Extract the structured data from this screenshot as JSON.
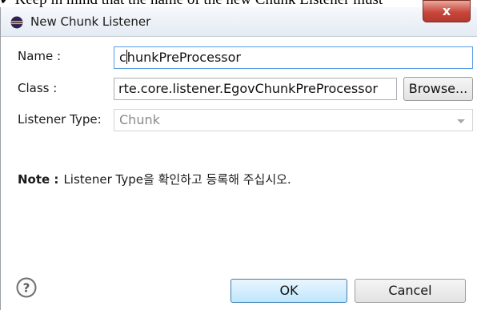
{
  "caption": {
    "text": "Keep in mind that the name of the new Chunk Listener must"
  },
  "window": {
    "title": "New Chunk Listener",
    "close_glyph": "x"
  },
  "form": {
    "name_label": "Name :",
    "name_value_before_caret": "c",
    "name_value_after_caret": "hunkPreProcessor",
    "class_label": "Class :",
    "class_value": "rte.core.listener.EgovChunkPreProcessor",
    "browse_label": "Browse...",
    "listener_type_label": "Listener Type:",
    "listener_type_value": "Chunk"
  },
  "note": {
    "label": "Note :",
    "text": "Listener Type을 확인하고 등록해 주십시오."
  },
  "buttons": {
    "ok": "OK",
    "cancel": "Cancel"
  },
  "icons": {
    "app": "eclipse-icon",
    "help": "help-icon",
    "close": "close-icon",
    "dropdown": "chevron-down-icon"
  },
  "colors": {
    "focus_border": "#569de5",
    "default_button": "#bee6fd",
    "close_button": "#c9463b"
  }
}
